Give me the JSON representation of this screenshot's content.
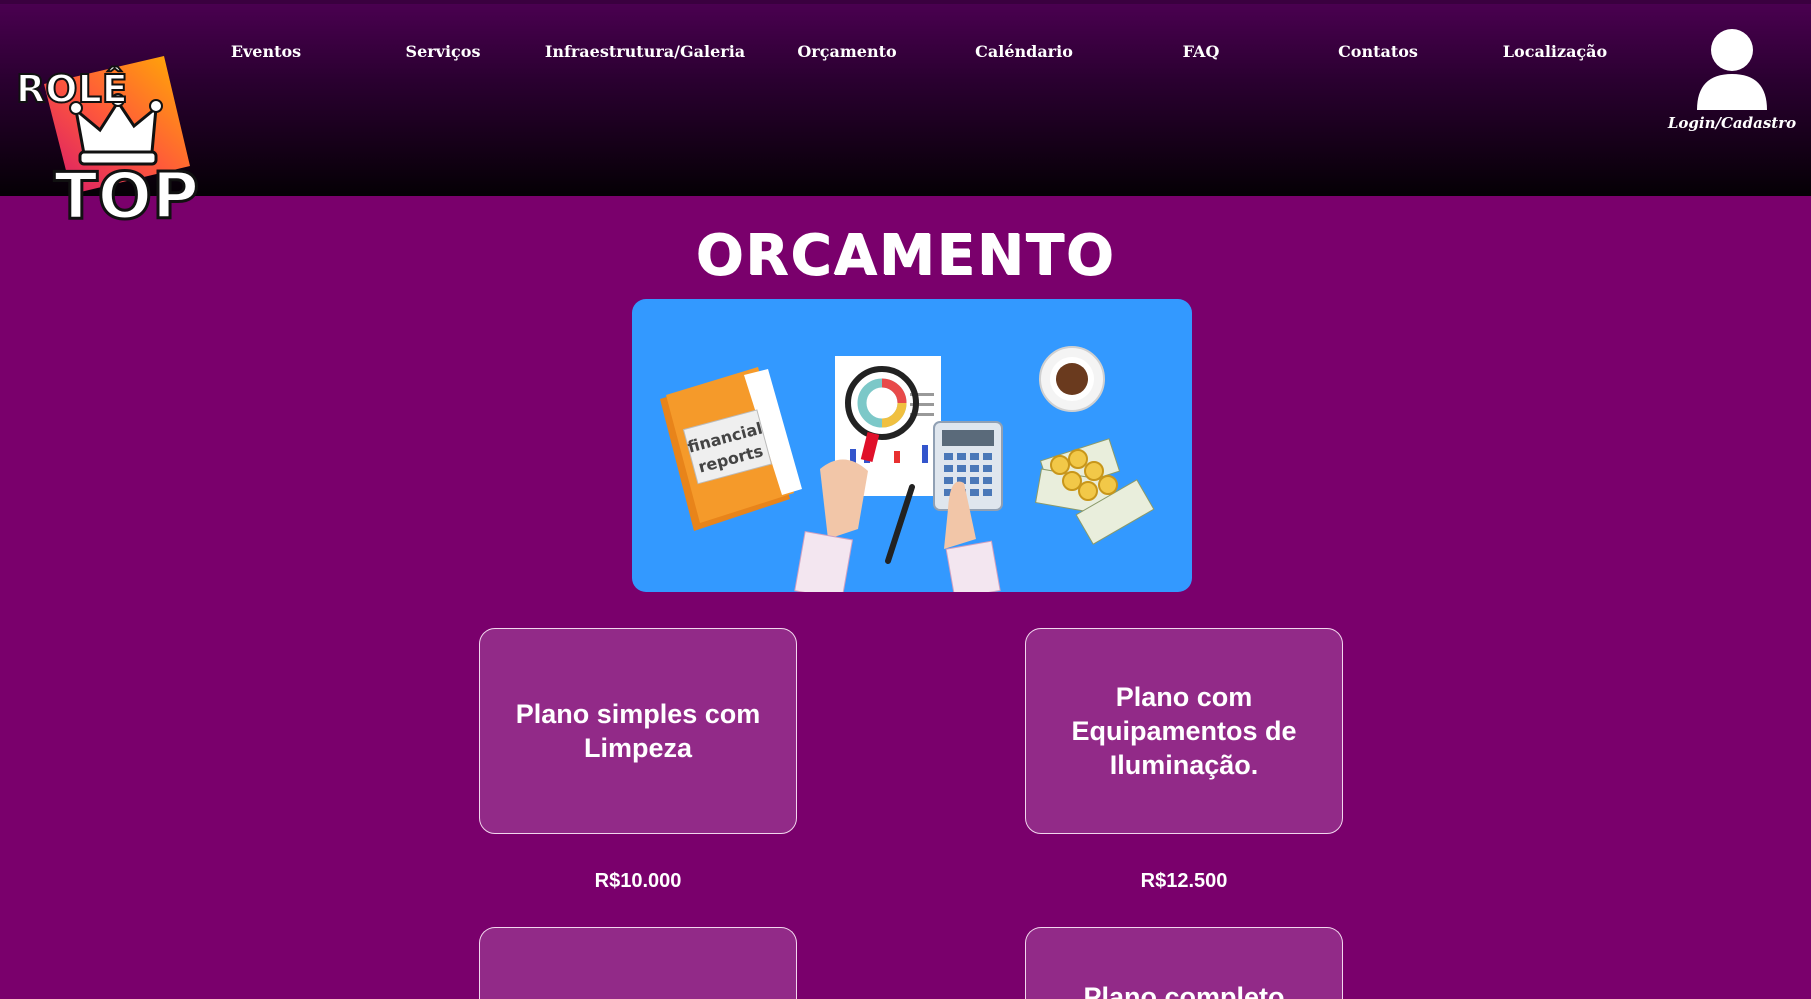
{
  "nav": {
    "items": [
      {
        "label": "Eventos"
      },
      {
        "label": "Serviços"
      },
      {
        "label": "Infraestrutura/Galeria"
      },
      {
        "label": "Orçamento"
      },
      {
        "label": "Caléndario"
      },
      {
        "label": "FAQ"
      },
      {
        "label": "Contatos"
      },
      {
        "label": "Localização"
      }
    ]
  },
  "user": {
    "label": "Login/Cadastro",
    "icon": "user-icon"
  },
  "logo": {
    "line1": "ROLÊ",
    "line2": "TOP",
    "icon": "crown-icon"
  },
  "page": {
    "title": "ORCAMENTO"
  },
  "hero": {
    "folder_label_line1": "financial",
    "folder_label_line2": "reports"
  },
  "plans": [
    {
      "title": "Plano simples com Limpeza",
      "price": "R$10.000"
    },
    {
      "title": "Plano com Equipamentos de Iluminação.",
      "price": "R$12.500"
    },
    {
      "title": "",
      "price": ""
    },
    {
      "title": "Plano completo com",
      "price": ""
    }
  ],
  "colors": {
    "background": "#7a006c",
    "card": "#922a88",
    "hero": "#3399ff"
  }
}
